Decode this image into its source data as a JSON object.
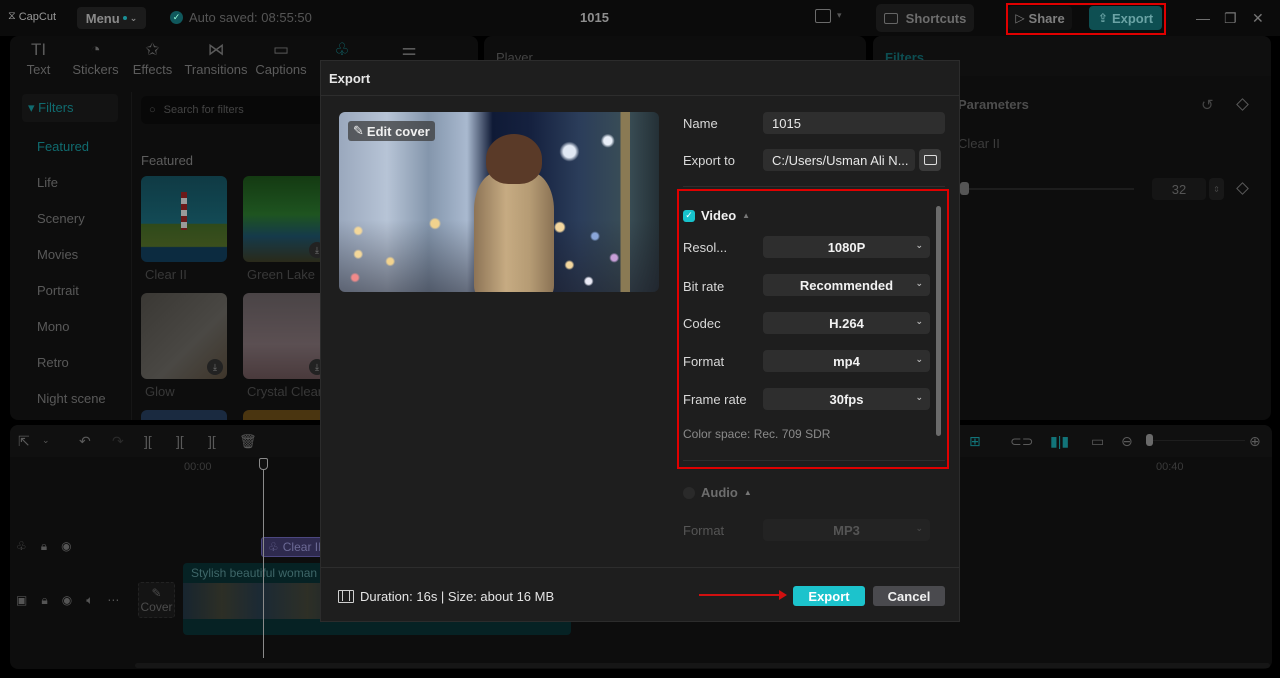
{
  "titlebar": {
    "app_name": "CapCut",
    "menu_label": "Menu",
    "autosave_text": "Auto saved: 08:55:50",
    "project_title": "1015",
    "shortcuts_label": "Shortcuts",
    "share_label": "Share",
    "export_label": "Export",
    "window_controls": [
      "minimize",
      "restore",
      "close"
    ]
  },
  "media_panel": {
    "tabs": [
      {
        "label": "Text",
        "icon": "text-icon",
        "glyph": "TI"
      },
      {
        "label": "Stickers",
        "icon": "sticker-icon",
        "glyph": "◔"
      },
      {
        "label": "Effects",
        "icon": "effects-star-icon",
        "glyph": "✩"
      },
      {
        "label": "Transitions",
        "icon": "transitions-icon",
        "glyph": "⋈"
      },
      {
        "label": "Captions",
        "icon": "captions-icon",
        "glyph": "▭"
      },
      {
        "label": "",
        "icon": "filters-icon",
        "glyph": "♧",
        "active": true
      },
      {
        "label": "",
        "icon": "adjustment-icon",
        "glyph": "⚌"
      }
    ],
    "filters_header": "▾ Filters",
    "search_placeholder": "Search for filters",
    "categories": [
      "Featured",
      "Life",
      "Scenery",
      "Movies",
      "Portrait",
      "Mono",
      "Retro",
      "Night scene"
    ],
    "active_category": "Featured",
    "section_title": "Featured",
    "filters": [
      {
        "name": "Clear II",
        "downloaded": true
      },
      {
        "name": "Green Lake",
        "downloaded": false
      },
      {
        "name": "Glow",
        "downloaded": false
      },
      {
        "name": "Crystal Clear",
        "downloaded": false
      }
    ]
  },
  "player": {
    "label": "Player"
  },
  "right_panel": {
    "title": "Filters",
    "params_label": "Parameters",
    "filter_name": "Clear II",
    "intensity_value": "32",
    "intensity_fraction": 0.32
  },
  "timeline": {
    "ruler": [
      "00:00",
      "00:40"
    ],
    "filter_clip": "Clear II",
    "video_clip": "Stylish beautiful woman walking",
    "cover_label": "Cover"
  },
  "export_dialog": {
    "title": "Export",
    "edit_cover_label": "Edit cover",
    "name_label": "Name",
    "name_value": "1015",
    "export_to_label": "Export to",
    "export_to_value": "C:/Users/Usman Ali N...",
    "video": {
      "title": "Video",
      "checked": true,
      "fields": [
        {
          "label": "Resol...",
          "value": "1080P"
        },
        {
          "label": "Bit rate",
          "value": "Recommended"
        },
        {
          "label": "Codec",
          "value": "H.264"
        },
        {
          "label": "Format",
          "value": "mp4"
        },
        {
          "label": "Frame rate",
          "value": "30fps"
        }
      ],
      "color_space": "Color space: Rec. 709 SDR"
    },
    "audio": {
      "title": "Audio",
      "checked": false,
      "fields": [
        {
          "label": "Format",
          "value": "MP3"
        }
      ]
    },
    "duration_text": "Duration: 16s | Size: about 16 MB",
    "export_button": "Export",
    "cancel_button": "Cancel"
  },
  "colors": {
    "accent": "#1cc3cc",
    "annotation_red": "#e00000",
    "dialog_bg": "#1e1e1e"
  }
}
